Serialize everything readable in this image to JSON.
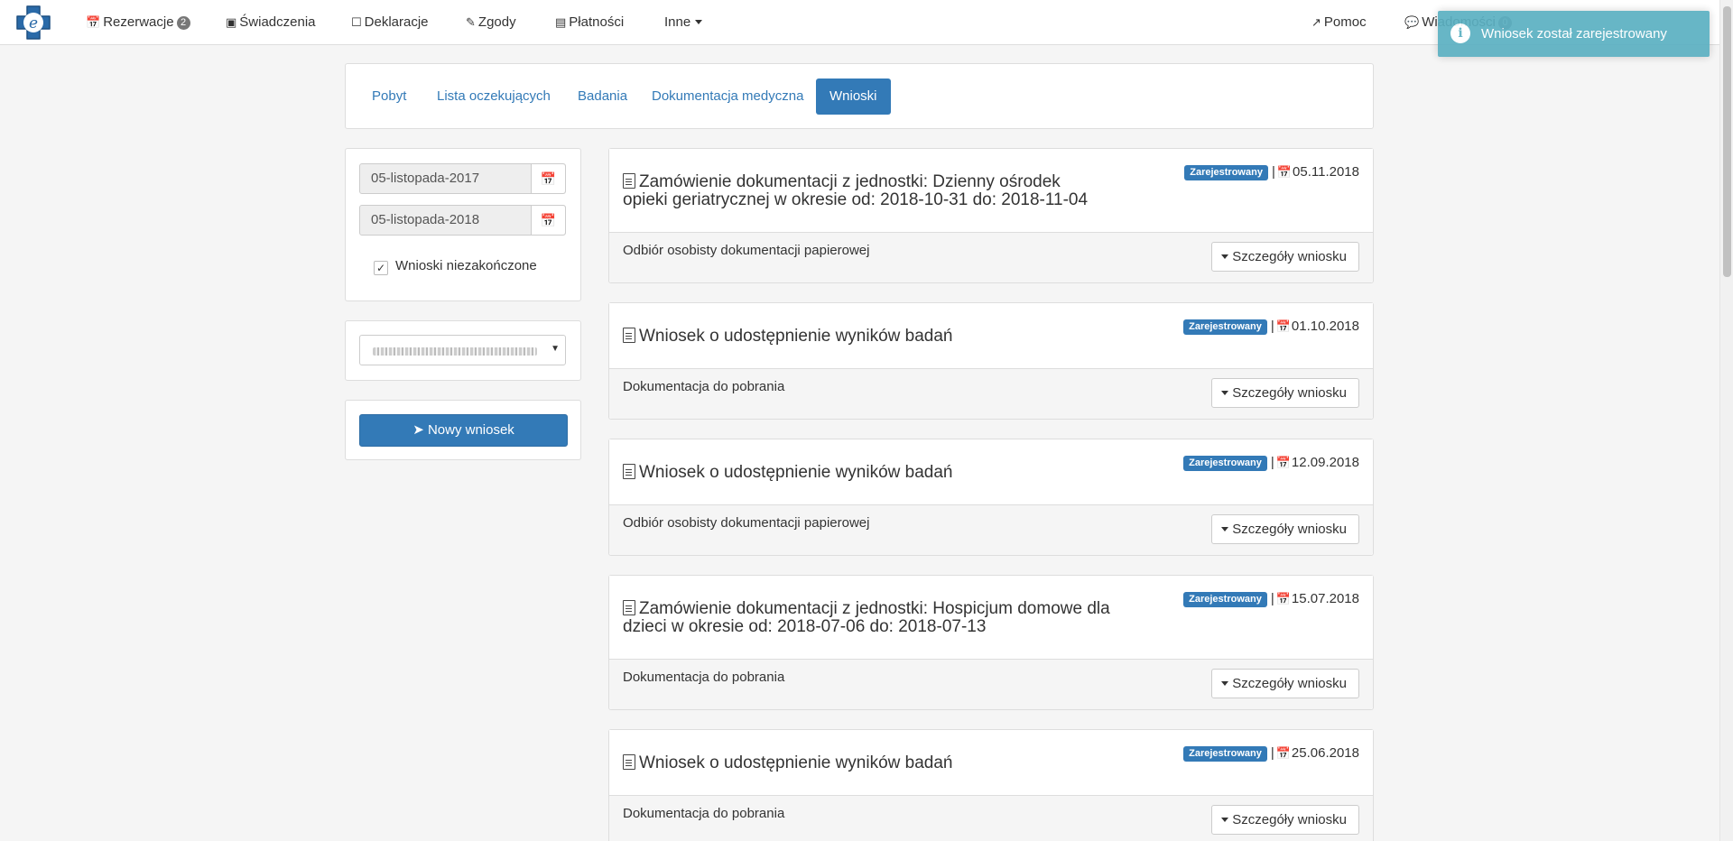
{
  "colors": {
    "brand": "#337ab7",
    "toast": "#5bb0c2",
    "status_badge": "#337ab7",
    "page_bg": "#f5f5f5"
  },
  "nav": {
    "items": [
      {
        "icon": "calendar-icon",
        "label": "Rezerwacje",
        "badge": "2"
      },
      {
        "icon": "medkit-icon",
        "label": "Świadczenia"
      },
      {
        "icon": "file-icon",
        "label": "Deklaracje"
      },
      {
        "icon": "edit-icon",
        "label": "Zgody"
      },
      {
        "icon": "credit-card-icon",
        "label": "Płatności"
      },
      {
        "label": "Inne"
      }
    ],
    "right": [
      {
        "icon": "external-link-icon",
        "label": "Pomoc"
      },
      {
        "icon": "comments-icon",
        "label": "Wiadomości",
        "badge": "0"
      }
    ]
  },
  "toast": {
    "message": "Wniosek został zarejestrowany"
  },
  "tabs": [
    "Pobyt",
    "Lista oczekujących",
    "Badania",
    "Dokumentacja medyczna",
    "Wnioski"
  ],
  "filters": {
    "date_from": "05-listopada-2017",
    "date_to": "05-listopada-2018",
    "unfinished_label": "Wnioski niezakończone"
  },
  "new_request_label": "Nowy wniosek",
  "status_label": "Zarejestrowany",
  "details_label": "Szczegóły wniosku",
  "requests": [
    {
      "title_line1": "Zamówienie dokumentacji z jednostki: Dzienny ośrodek",
      "title_line2": "opieki geriatrycznej w okresie od: 2018-10-31 do: 2018-11-04",
      "date": "05.11.2018",
      "desc": "Odbiór osobisty dokumentacji papierowej"
    },
    {
      "title_line1": "Wniosek o udostępnienie wyników badań",
      "date": "01.10.2018",
      "desc": "Dokumentacja do pobrania"
    },
    {
      "title_line1": "Wniosek o udostępnienie wyników badań",
      "date": "12.09.2018",
      "desc": "Odbiór osobisty dokumentacji papierowej"
    },
    {
      "title_line1": "Zamówienie dokumentacji z jednostki: Hospicjum domowe dla",
      "title_line2": "dzieci w okresie od: 2018-07-06 do: 2018-07-13",
      "date": "15.07.2018",
      "desc": "Dokumentacja do pobrania"
    },
    {
      "title_line1": "Wniosek o udostępnienie wyników badań",
      "date": "25.06.2018",
      "desc": "Dokumentacja do pobrania"
    }
  ]
}
